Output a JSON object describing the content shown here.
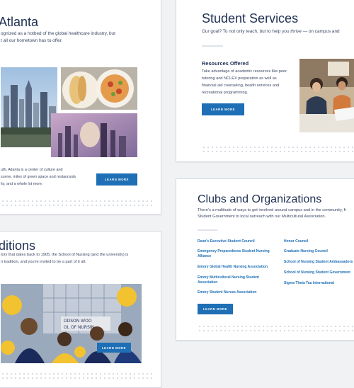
{
  "atlanta": {
    "title": "Atlanta",
    "intro_l1": "ognized as a hotbed of the global healthcare industry, but",
    "intro_l2": "t all our hometown has to offer.",
    "body_l1": "uth, Atlanta is a center of culture and",
    "body_l2": "scene, miles of green space and restaurants",
    "body_l3": "ity, and a whole lot more.",
    "button": "LEARN MORE"
  },
  "student_services": {
    "title": "Student Services",
    "intro_a": "Our goal? To not only teach, but to help you ",
    "intro_em": "thrive",
    "intro_b": " — on campus and",
    "subhead": "Resources Offered",
    "body_l1": "Take advantage of academic resources like peer",
    "body_l2": "tutoring and NCLEX preparation as well as",
    "body_l3": "financial aid counseling, health services and",
    "body_l4": "recreational programming.",
    "button": "LEARN MORE"
  },
  "traditions": {
    "title": "ditions",
    "body_l1": "tory that dates back to 1905, the School of Nursing (and the university) is",
    "body_l2": "n tradition, and you're invited to be a part of it all.",
    "button": "LEARN MORE",
    "sign_l1": "DDSON WOO",
    "sign_l2": "OL OF NURSIN"
  },
  "clubs": {
    "title": "Clubs and Organizations",
    "intro_l1": "There's a multitude of ways to get involved around campus and in the community, fr",
    "intro_l2": "Student Government to local outreach with our Multicultural Association.",
    "left_items": [
      "Dean's Executive Student Council",
      "Emergency Preparedness Student Nursing Alliance",
      "Emory Global Health Nursing Association",
      "Emory Multicultural Nursing Student Association",
      "Emory Student Nurses Association"
    ],
    "right_items": [
      "Honor Council",
      "Graduate Nursing Council",
      "School of Nursing Student Ambassadors",
      "School of Nursing Student Government",
      "Sigma Theta Tau International"
    ],
    "button": "LEARN MORE"
  },
  "colors": {
    "accent": "#1e6fb5",
    "heading": "#1e2f52"
  }
}
